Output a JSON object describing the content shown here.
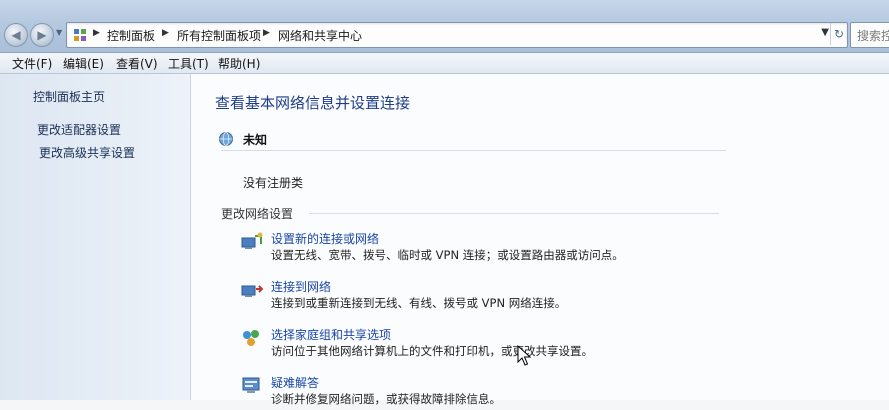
{
  "address": {
    "breadcrumbs": [
      "控制面板",
      "所有控制面板项",
      "网络和共享中心"
    ],
    "search_placeholder": "搜索控制面板"
  },
  "menu": [
    "文件(F)",
    "编辑(E)",
    "查看(V)",
    "工具(T)",
    "帮助(H)"
  ],
  "sidebar": {
    "home": "控制面板主页",
    "links": [
      "更改适配器设置",
      "更改高级共享设置"
    ]
  },
  "main": {
    "title": "查看基本网络信息并设置连接",
    "network_name": "未知",
    "no_registration": "没有注册类",
    "section_header": "更改网络设置",
    "tasks": [
      {
        "link": "设置新的连接或网络",
        "desc": "设置无线、宽带、拨号、临时或 VPN 连接；或设置路由器或访问点。",
        "icon": "new-connection-icon"
      },
      {
        "link": "连接到网络",
        "desc": "连接到或重新连接到无线、有线、拨号或 VPN 网络连接。",
        "icon": "connect-network-icon"
      },
      {
        "link": "选择家庭组和共享选项",
        "desc": "访问位于其他网络计算机上的文件和打印机，或更改共享设置。",
        "icon": "homegroup-icon"
      },
      {
        "link": "疑难解答",
        "desc": "诊断并修复网络问题，或获得故障排除信息。",
        "icon": "troubleshoot-icon"
      }
    ]
  },
  "colors": {
    "link": "#1a46a8",
    "title": "#1f3c88",
    "nav_text": "#1a2f55"
  }
}
